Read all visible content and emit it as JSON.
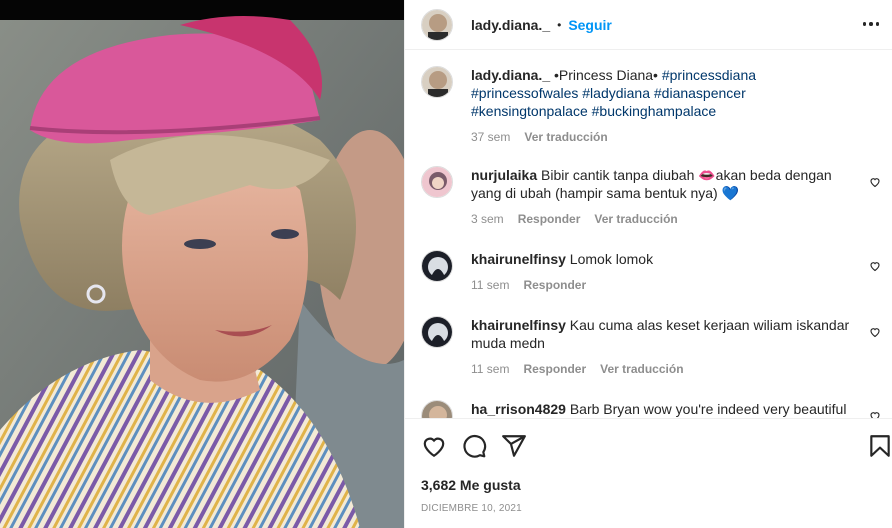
{
  "post": {
    "username": "lady.diana._",
    "separator": "•",
    "follow_label": "Seguir"
  },
  "caption": {
    "username": "lady.diana._",
    "text": " •Princess Diana• ",
    "hashtags": "#princessdiana #princessofwales #ladydiana #dianaspencer #kensingtonpalace #buckinghampalace",
    "time": "37 sem",
    "translate": "Ver traducción"
  },
  "comments": [
    {
      "username": "nurjulaika",
      "text": " Bibir cantik tanpa diubah 👄akan beda dengan yang di ubah (hampir sama bentuk nya) 💙",
      "time": "3 sem",
      "reply": "Responder",
      "translate": "Ver traducción"
    },
    {
      "username": "khairunelfinsy",
      "text": " Lomok lomok",
      "time": "11 sem",
      "reply": "Responder"
    },
    {
      "username": "khairunelfinsy",
      "text": " Kau cuma alas keset kerjaan wiliam iskandar muda medn",
      "time": "11 sem",
      "reply": "Responder",
      "translate": "Ver traducción"
    },
    {
      "username": "ha_rrison4829",
      "text": " Barb Bryan wow you're indeed very beautiful"
    }
  ],
  "actions": {
    "likes": "3,682 Me gusta",
    "date": "DICIEMBRE 10, 2021"
  },
  "icons": [
    "heart-icon",
    "comment-icon",
    "share-icon",
    "bookmark-icon",
    "more-icon"
  ],
  "colors": {
    "accent": "#0095f6",
    "muted": "#8e8e8e",
    "hashtag": "#00376b",
    "hat": "#d9589a"
  }
}
